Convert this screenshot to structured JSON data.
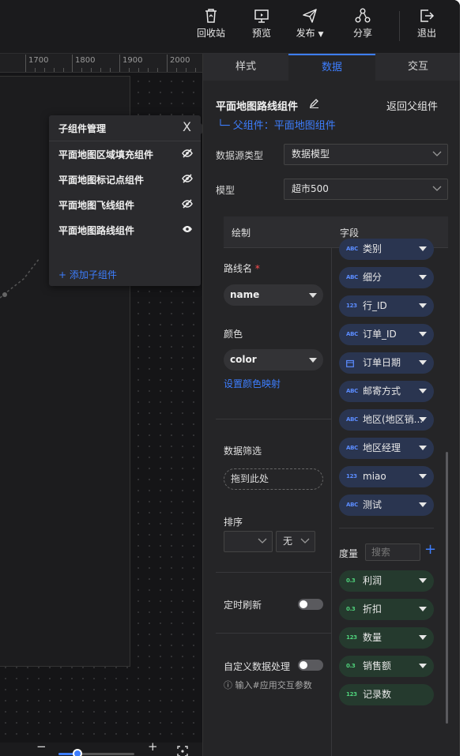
{
  "toolbar": {
    "recycle": "回收站",
    "preview": "预览",
    "publish": "发布",
    "share": "分享",
    "exit": "退出"
  },
  "ruler": {
    "ticks": [
      "1700",
      "1800",
      "1900",
      "2000"
    ]
  },
  "popup": {
    "title": "子组件管理",
    "close": "X",
    "items": [
      {
        "label": "平面地图区域填充组件",
        "visible": false
      },
      {
        "label": "平面地图标记点组件",
        "visible": false
      },
      {
        "label": "平面地图飞线组件",
        "visible": false
      },
      {
        "label": "平面地图路线组件",
        "visible": true
      }
    ],
    "add": "+ 添加子组件"
  },
  "zoom": {
    "minus": "−",
    "plus": "+",
    "level": 0.25
  },
  "panel": {
    "tabs": [
      "样式",
      "数据",
      "交互"
    ],
    "active_tab": "数据",
    "title": "平面地图路线组件",
    "back": "返回父组件",
    "parent": "└─ 父组件：平面地图组件",
    "source_type_label": "数据源类型",
    "source_type_value": "数据模型",
    "model_label": "模型",
    "model_value": "超市500",
    "col_draw": "绘制",
    "col_field": "字段",
    "route_label": "路线名",
    "required": "*",
    "route_value": "name",
    "color_label": "颜色",
    "color_value": "color",
    "color_map_link": "设置颜色映射",
    "filter_label": "数据筛选",
    "drop_here": "拖到此处",
    "sort_label": "排序",
    "sort_order": "无",
    "refresh_label": "定时刷新",
    "custom_label": "自定义数据处理",
    "hint": "ⓘ 输入#应用交互参数",
    "measure_label": "度量",
    "search_placeholder": "搜索",
    "add_icon": "+"
  },
  "dimensions": [
    {
      "type": "ABC",
      "name": "类别"
    },
    {
      "type": "ABC",
      "name": "细分"
    },
    {
      "type": "123",
      "name": "行_ID"
    },
    {
      "type": "ABC",
      "name": "订单_ID"
    },
    {
      "type": "date",
      "name": "订单日期"
    },
    {
      "type": "ABC",
      "name": "邮寄方式"
    },
    {
      "type": "ABC",
      "name": "地区(地区销..."
    },
    {
      "type": "ABC",
      "name": "地区经理"
    },
    {
      "type": "123",
      "name": "miao"
    },
    {
      "type": "ABC",
      "name": "测试"
    }
  ],
  "measures": [
    {
      "type": "0.3",
      "name": "利润"
    },
    {
      "type": "0.3",
      "name": "折扣"
    },
    {
      "type": "123",
      "name": "数量"
    },
    {
      "type": "0.3",
      "name": "销售额"
    },
    {
      "type": "123",
      "name": "记录数"
    }
  ],
  "colors": {
    "accent": "#3d7eff",
    "bg": "#1f1f21",
    "dimension_chip": "#2a3550",
    "measure_chip": "#253a2e"
  }
}
